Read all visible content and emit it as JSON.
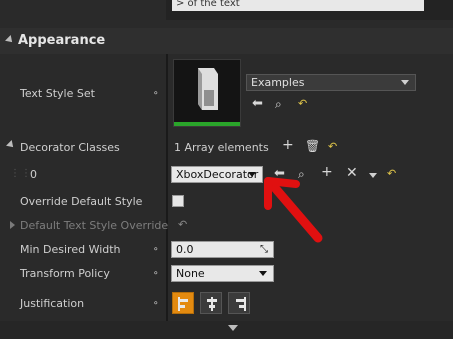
{
  "top": {
    "field_text": "> of the text"
  },
  "category": {
    "title": "Appearance"
  },
  "rows": {
    "text_style_set": {
      "label": "Text Style Set",
      "dropdown_value": "Examples"
    },
    "decorator_classes": {
      "label": "Decorator Classes",
      "count_text": "1 Array elements"
    },
    "element0": {
      "index": "0",
      "dropdown_value": "XboxDecorator"
    },
    "override_default_style": {
      "label": "Override Default Style",
      "checked": false
    },
    "default_text_style_override": {
      "label": "Default Text Style Override"
    },
    "min_desired_width": {
      "label": "Min Desired Width",
      "value": "0.0"
    },
    "transform_policy": {
      "label": "Transform Policy",
      "value": "None"
    },
    "justification": {
      "label": "Justification",
      "selected": "left"
    }
  },
  "colors": {
    "accent_orange": "#e38a10",
    "thumb_green": "#2aa52a",
    "annotation_red": "#e01010"
  }
}
